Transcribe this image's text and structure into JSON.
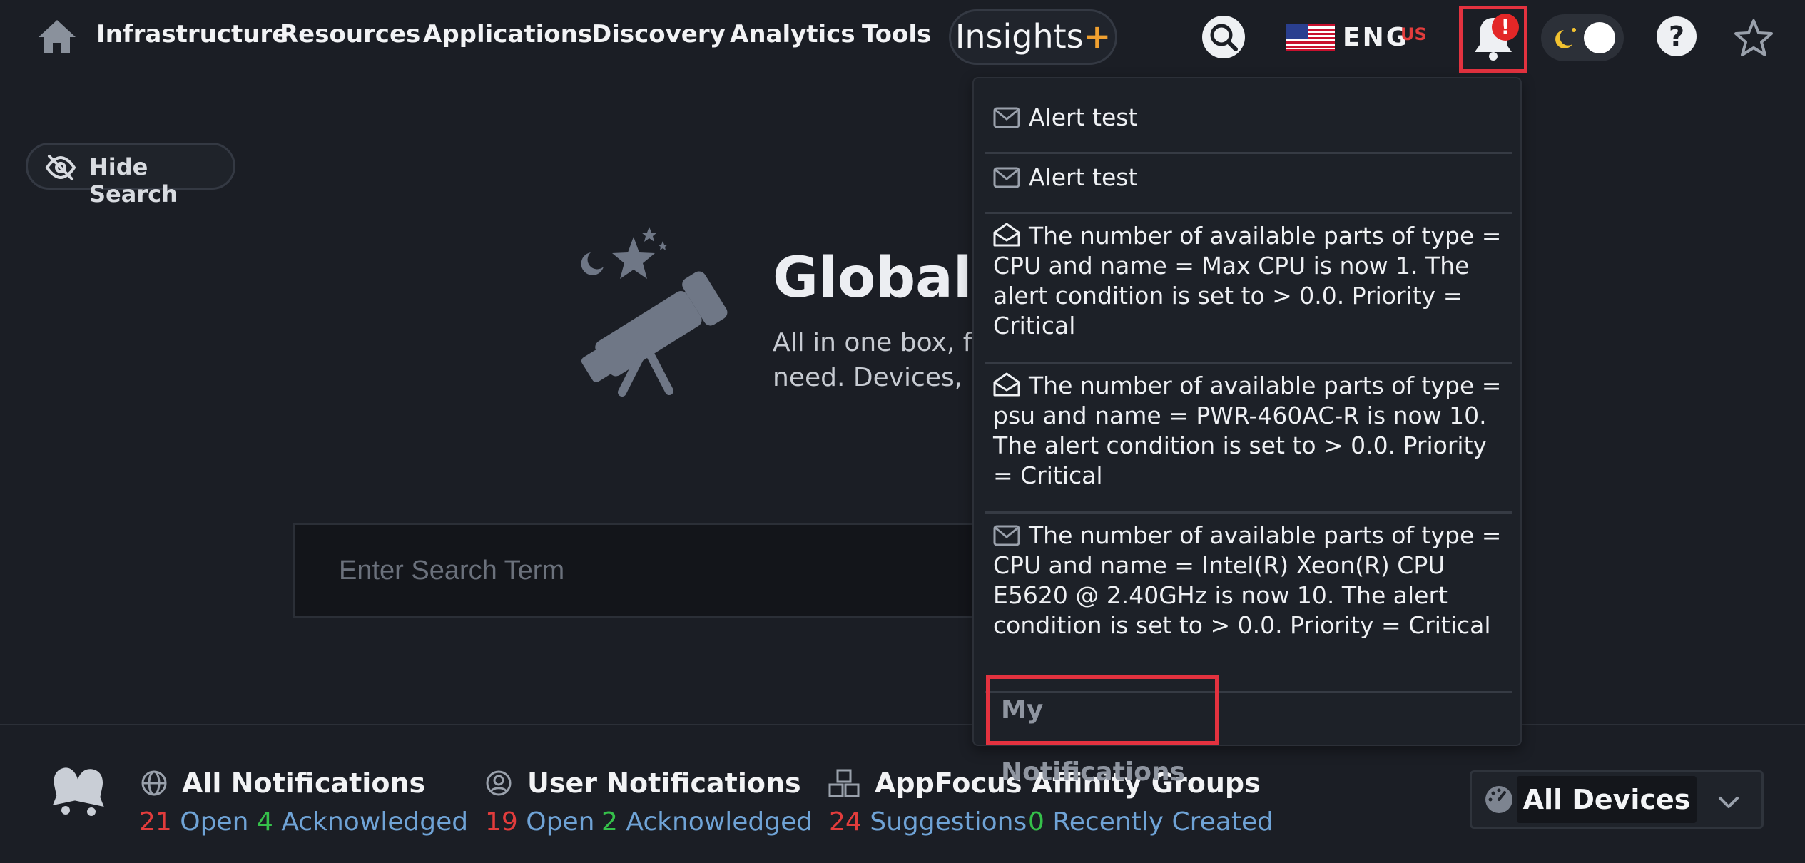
{
  "nav": {
    "items": [
      "Infrastructure",
      "Resources",
      "Applications",
      "Discovery",
      "Analytics",
      "Tools"
    ],
    "insights_label": "Insights",
    "insights_plus": "+",
    "language": "ENG",
    "language_region": "US",
    "alert_badge": "!",
    "help_label": "?"
  },
  "hide_search": {
    "label": "Hide Search"
  },
  "hero": {
    "title": "Global S",
    "subtitle_line1": "All in one box, fi",
    "subtitle_line2": "need. Devices, I"
  },
  "search": {
    "placeholder": "Enter Search Term"
  },
  "notifications": {
    "items": [
      {
        "icon": "envelope-icon",
        "text": "Alert test"
      },
      {
        "icon": "envelope-icon",
        "text": "Alert test"
      },
      {
        "icon": "envelope-open-icon",
        "text": "The number of available parts of type = CPU and name = Max CPU is now 1. The alert condition is set to > 0.0. Priority = Critical"
      },
      {
        "icon": "envelope-open-icon",
        "text": "The number of available parts of type = psu and name = PWR-460AC-R is now 10. The alert condition is set to > 0.0. Priority = Critical"
      },
      {
        "icon": "envelope-icon",
        "text": "The number of available parts of type = CPU and name = Intel(R) Xeon(R) CPU E5620 @ 2.40GHz is now 10. The alert condition is set to > 0.0. Priority = Critical"
      }
    ],
    "footer_link": "My Notifications"
  },
  "footer": {
    "all": {
      "title": "All Notifications",
      "open_count": "21",
      "open_label": "Open",
      "ack_count": "4",
      "ack_label": "Acknowledged"
    },
    "user": {
      "title": "User Notifications",
      "open_count": "19",
      "open_label": "Open",
      "ack_count": "2",
      "ack_label": "Acknowledged"
    },
    "appfocus": {
      "title": "AppFocus Affinity Groups",
      "sugg_count": "24",
      "sugg_label": "Suggestions",
      "recent_count": "0",
      "recent_label": "Recently Created"
    },
    "devices_label": "All Devices"
  },
  "colors": {
    "background": "#1b1e25",
    "highlight_red": "#e3323f",
    "accent_orange": "#f0a030"
  }
}
